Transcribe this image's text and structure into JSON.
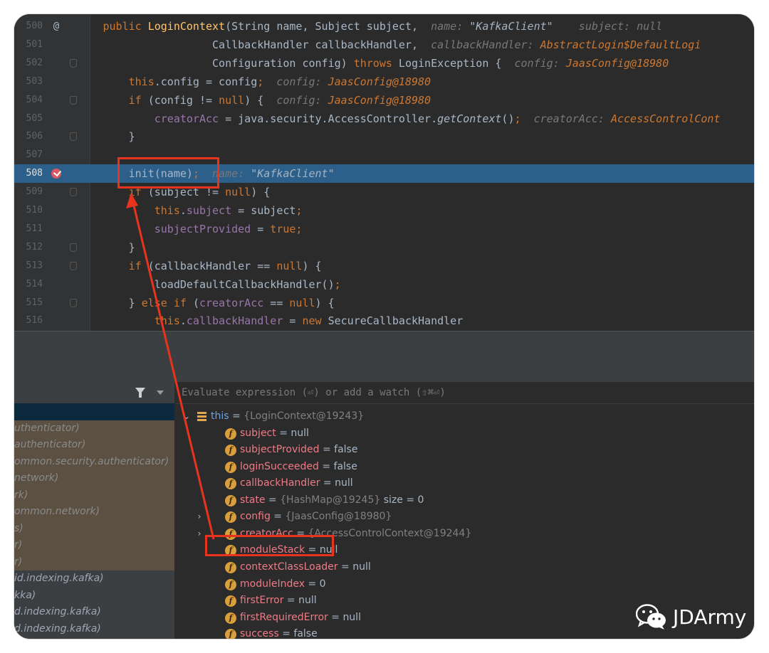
{
  "editor": {
    "lines": [
      {
        "num": "500",
        "gicon": "@",
        "fold": false,
        "tokens": [
          [
            "",
            "                "
          ],
          [
            "kw",
            "public "
          ],
          [
            "fn",
            "LoginContext"
          ],
          [
            "",
            "(String name, Subject subject,  "
          ],
          [
            "hint",
            "name: "
          ],
          [
            "hs",
            "\"KafkaClient\""
          ],
          [
            "hint",
            "    subject: null"
          ]
        ]
      },
      {
        "num": "501",
        "gicon": "",
        "fold": false,
        "tokens": [
          [
            "",
            "                                 CallbackHandler callbackHandler,  "
          ],
          [
            "hint",
            "callbackHandler: "
          ],
          [
            "hv",
            "AbstractLogin$DefaultLogi"
          ]
        ]
      },
      {
        "num": "502",
        "gicon": "",
        "fold": true,
        "tokens": [
          [
            "",
            "                                 Configuration config) "
          ],
          [
            "kw",
            "throws "
          ],
          [
            "",
            "LoginException {  "
          ],
          [
            "hint",
            "config: "
          ],
          [
            "hv",
            "JaasConfig@18980"
          ]
        ]
      },
      {
        "num": "503",
        "gicon": "",
        "fold": false,
        "tokens": [
          [
            "",
            "                    "
          ],
          [
            "kw",
            "this"
          ],
          [
            "",
            ".config = config"
          ],
          [
            "kw",
            ";"
          ],
          [
            "hint",
            "  config: "
          ],
          [
            "hv",
            "JaasConfig@18980"
          ]
        ]
      },
      {
        "num": "504",
        "gicon": "",
        "fold": true,
        "tokens": [
          [
            "",
            "                    "
          ],
          [
            "kw",
            "if "
          ],
          [
            "",
            "(config != "
          ],
          [
            "kw",
            "null"
          ],
          [
            "",
            ") {  "
          ],
          [
            "hint",
            "config: "
          ],
          [
            "hv",
            "JaasConfig@18980"
          ]
        ]
      },
      {
        "num": "505",
        "gicon": "",
        "fold": false,
        "tokens": [
          [
            "",
            "                        "
          ],
          [
            "fld",
            "creatorAcc"
          ],
          [
            "",
            " = java.security.AccessController."
          ],
          [
            "ital",
            "getContext"
          ],
          [
            "",
            "()"
          ],
          [
            "kw",
            ";"
          ],
          [
            "hint",
            "  creatorAcc: "
          ],
          [
            "hv",
            "AccessControlCont"
          ]
        ]
      },
      {
        "num": "506",
        "gicon": "",
        "fold": true,
        "tokens": [
          [
            "",
            "                    }"
          ]
        ]
      },
      {
        "num": "507",
        "gicon": "",
        "fold": false,
        "tokens": [
          [
            "",
            ""
          ]
        ]
      },
      {
        "num": "508",
        "gicon": "breakpoint",
        "fold": false,
        "exec": true,
        "tokens": [
          [
            "",
            "                    init(name)"
          ],
          [
            "kw",
            ";"
          ],
          [
            "hint",
            "  name: "
          ],
          [
            "hs",
            "\"KafkaClient\""
          ]
        ]
      },
      {
        "num": "509",
        "gicon": "",
        "fold": true,
        "tokens": [
          [
            "",
            "                    "
          ],
          [
            "kw",
            "if "
          ],
          [
            "",
            "(subject != "
          ],
          [
            "kw",
            "null"
          ],
          [
            "",
            ") {"
          ]
        ]
      },
      {
        "num": "510",
        "gicon": "",
        "fold": false,
        "tokens": [
          [
            "",
            "                        "
          ],
          [
            "kw",
            "this"
          ],
          [
            "",
            "."
          ],
          [
            "fld",
            "subject"
          ],
          [
            "",
            " = subject"
          ],
          [
            "kw",
            ";"
          ]
        ]
      },
      {
        "num": "511",
        "gicon": "",
        "fold": false,
        "tokens": [
          [
            "",
            "                        "
          ],
          [
            "fld",
            "subjectProvided"
          ],
          [
            "",
            " = "
          ],
          [
            "kw",
            "true;"
          ]
        ]
      },
      {
        "num": "512",
        "gicon": "",
        "fold": true,
        "tokens": [
          [
            "",
            "                    }"
          ]
        ]
      },
      {
        "num": "513",
        "gicon": "",
        "fold": true,
        "tokens": [
          [
            "",
            "                    "
          ],
          [
            "kw",
            "if "
          ],
          [
            "",
            "(callbackHandler == "
          ],
          [
            "kw",
            "null"
          ],
          [
            "",
            ") {"
          ]
        ]
      },
      {
        "num": "514",
        "gicon": "",
        "fold": false,
        "tokens": [
          [
            "",
            "                        loadDefaultCallbackHandler()"
          ],
          [
            "kw",
            ";"
          ]
        ]
      },
      {
        "num": "515",
        "gicon": "",
        "fold": true,
        "tokens": [
          [
            "",
            "                    } "
          ],
          [
            "kw",
            "else if "
          ],
          [
            "",
            "("
          ],
          [
            "fld",
            "creatorAcc"
          ],
          [
            "",
            " == "
          ],
          [
            "kw",
            "null"
          ],
          [
            "",
            ") {"
          ]
        ]
      },
      {
        "num": "516",
        "gicon": "",
        "fold": false,
        "tokens": [
          [
            "",
            "                        "
          ],
          [
            "kw",
            "this"
          ],
          [
            "",
            "."
          ],
          [
            "fld",
            "callbackHandler"
          ],
          [
            "",
            " = "
          ],
          [
            "kw",
            "new "
          ],
          [
            "",
            "SecureCallbackHandler"
          ]
        ]
      }
    ]
  },
  "debugger": {
    "eval_placeholder": "Evaluate expression (⏎) or add a watch (⇧⌘⏎)",
    "frames": [
      {
        "text": "",
        "style": "sel"
      },
      {
        "text": "uthenticator)",
        "style": "lib"
      },
      {
        "text": "authenticator)",
        "style": "lib"
      },
      {
        "text": "ommon.security.authenticator)",
        "style": "lib"
      },
      {
        "text": "network)",
        "style": "lib"
      },
      {
        "text": "rk)",
        "style": "lib"
      },
      {
        "text": "ommon.network)",
        "style": "lib"
      },
      {
        "text": "s)",
        "style": "lib"
      },
      {
        "text": "r)",
        "style": "lib"
      },
      {
        "text": "r)",
        "style": "lib"
      },
      {
        "text": "id.indexing.kafka)",
        "style": "plain"
      },
      {
        "text": "kka)",
        "style": "plain"
      },
      {
        "text": "d.indexing.kafka)",
        "style": "plain"
      },
      {
        "text": "d.indexing.kafka)",
        "style": "plain"
      }
    ],
    "variables": [
      {
        "kind": "this",
        "expand": "⌄",
        "name": "this",
        "eq": " = ",
        "value": "{LoginContext@19243}",
        "extra": ""
      },
      {
        "kind": "field",
        "expand": "",
        "name": "subject",
        "eq": " = ",
        "value": "null",
        "extra": ""
      },
      {
        "kind": "field",
        "expand": "",
        "name": "subjectProvided",
        "eq": " = ",
        "value": "false",
        "extra": ""
      },
      {
        "kind": "field",
        "expand": "",
        "name": "loginSucceeded",
        "eq": " = ",
        "value": "false",
        "extra": ""
      },
      {
        "kind": "field",
        "expand": "",
        "name": "callbackHandler",
        "eq": " = ",
        "value": "null",
        "extra": ""
      },
      {
        "kind": "field",
        "expand": "",
        "name": "state",
        "eq": " = ",
        "value": "{HashMap@19245}",
        "extra": "  size = 0",
        "muted": true
      },
      {
        "kind": "field",
        "expand": "›",
        "name": "config",
        "eq": " = ",
        "value": "{JaasConfig@18980}",
        "extra": "",
        "muted": true
      },
      {
        "kind": "field",
        "expand": "›",
        "name": "creatorAcc",
        "eq": " = ",
        "value": "{AccessControlContext@19244}",
        "extra": "",
        "muted": true
      },
      {
        "kind": "field",
        "expand": "",
        "name": "moduleStack",
        "eq": " = ",
        "value": "null",
        "extra": ""
      },
      {
        "kind": "field",
        "expand": "",
        "name": "contextClassLoader",
        "eq": " = ",
        "value": "null",
        "extra": ""
      },
      {
        "kind": "field",
        "expand": "",
        "name": "moduleIndex",
        "eq": " = ",
        "value": "0",
        "extra": ""
      },
      {
        "kind": "field",
        "expand": "",
        "name": "firstError",
        "eq": " = ",
        "value": "null",
        "extra": ""
      },
      {
        "kind": "field",
        "expand": "",
        "name": "firstRequiredError",
        "eq": " = ",
        "value": "null",
        "extra": ""
      },
      {
        "kind": "field",
        "expand": "",
        "name": "success",
        "eq": " = ",
        "value": "false",
        "extra": ""
      }
    ]
  },
  "watermark": {
    "text": "JDArmy"
  },
  "colors": {
    "annotation_red": "#e8331f",
    "exec_line": "#2d5f8b",
    "keyword": "#cc7832",
    "field": "#9876aa"
  }
}
